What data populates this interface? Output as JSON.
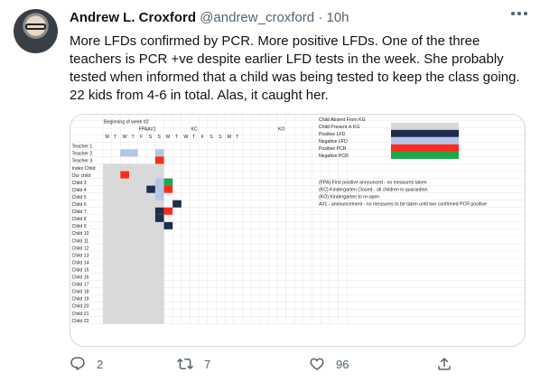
{
  "tweet": {
    "author_name": "Andrew L. Croxford",
    "handle": "@andrew_croxford",
    "separator": "·",
    "time": "10h",
    "text": "More LFDs confirmed by PCR. More positive LFDs. One of the three teachers is PCR +ve despite earlier LFD tests in the week. She probably tested when informed that a child was being tested to keep the class going. 22 kids from 4-6 in total. Alas, it caught her."
  },
  "actions": {
    "reply_count": "2",
    "retweet_count": "7",
    "like_count": "96",
    "icons": [
      "reply-icon",
      "retweet-icon",
      "like-icon",
      "share-icon"
    ]
  },
  "spreadsheet": {
    "week_label": "Beginning of week #2",
    "event_labels": [
      "FPA",
      "A#1",
      "KC",
      "KO"
    ],
    "day_headers": [
      "M",
      "T",
      "W",
      "T",
      "F",
      "S",
      "S",
      "M",
      "T",
      "W",
      "T",
      "F",
      "S",
      "S",
      "M",
      "T"
    ],
    "row_labels": [
      "Teacher 1",
      "Teacher 2",
      "Teacher 3",
      "Index Child",
      "Our child",
      "Child 3",
      "Child 4",
      "Child 5",
      "Child 6",
      "Child 7",
      "Child 8",
      "Child 9",
      "Child 10",
      "Child 11",
      "Child 12",
      "Child 13",
      "Child 14",
      "Child 15",
      "Child 16",
      "Child 17",
      "Child 18",
      "Child 19",
      "Child 20",
      "Child 21",
      "Child 22"
    ],
    "legend": [
      {
        "label": "Child Absent From KG",
        "color": ""
      },
      {
        "label": "Child Present in KG",
        "color": "#d9d9d9"
      },
      {
        "label": "Positive LFD",
        "color": "#1f2d4e"
      },
      {
        "label": "Negative LFD",
        "color": "#b4c6e7"
      },
      {
        "label": "Positive PCR",
        "color": "#ff2a1a"
      },
      {
        "label": "Negative PCR",
        "color": "#1fa84a"
      }
    ],
    "notes": [
      "(FPA) First positive announced - no measures taken",
      "(KC) Kindergarten Closed - all children in quarantine.",
      "(KO) Kindergarten to re-open",
      "A#1 -  announcement - no measures to be taken until two confirmed PCR positive"
    ],
    "colors": {
      "present": "#d9d9d9",
      "pos_lfd": "#1f2d4e",
      "neg_lfd": "#b4c6e7",
      "pos_pcr": "#ff2a1a",
      "neg_pcr": "#1fa84a"
    },
    "marks": [
      {
        "row": 1,
        "col": 2,
        "kind": "neg_lfd"
      },
      {
        "row": 1,
        "col": 3,
        "kind": "neg_lfd"
      },
      {
        "row": 1,
        "col": 6,
        "kind": "neg_lfd"
      },
      {
        "row": 2,
        "col": 6,
        "kind": "pos_pcr"
      },
      {
        "row": 4,
        "col": 2,
        "kind": "pos_pcr"
      },
      {
        "row": 5,
        "col": 6,
        "kind": "neg_lfd"
      },
      {
        "row": 5,
        "col": 7,
        "kind": "neg_pcr"
      },
      {
        "row": 6,
        "col": 5,
        "kind": "pos_lfd"
      },
      {
        "row": 6,
        "col": 6,
        "kind": "neg_lfd"
      },
      {
        "row": 6,
        "col": 7,
        "kind": "pos_pcr"
      },
      {
        "row": 7,
        "col": 6,
        "kind": "neg_lfd"
      },
      {
        "row": 8,
        "col": 8,
        "kind": "pos_lfd"
      },
      {
        "row": 9,
        "col": 6,
        "kind": "pos_lfd"
      },
      {
        "row": 9,
        "col": 7,
        "kind": "pos_pcr"
      },
      {
        "row": 10,
        "col": 6,
        "kind": "pos_lfd"
      },
      {
        "row": 11,
        "col": 7,
        "kind": "pos_lfd"
      }
    ]
  }
}
